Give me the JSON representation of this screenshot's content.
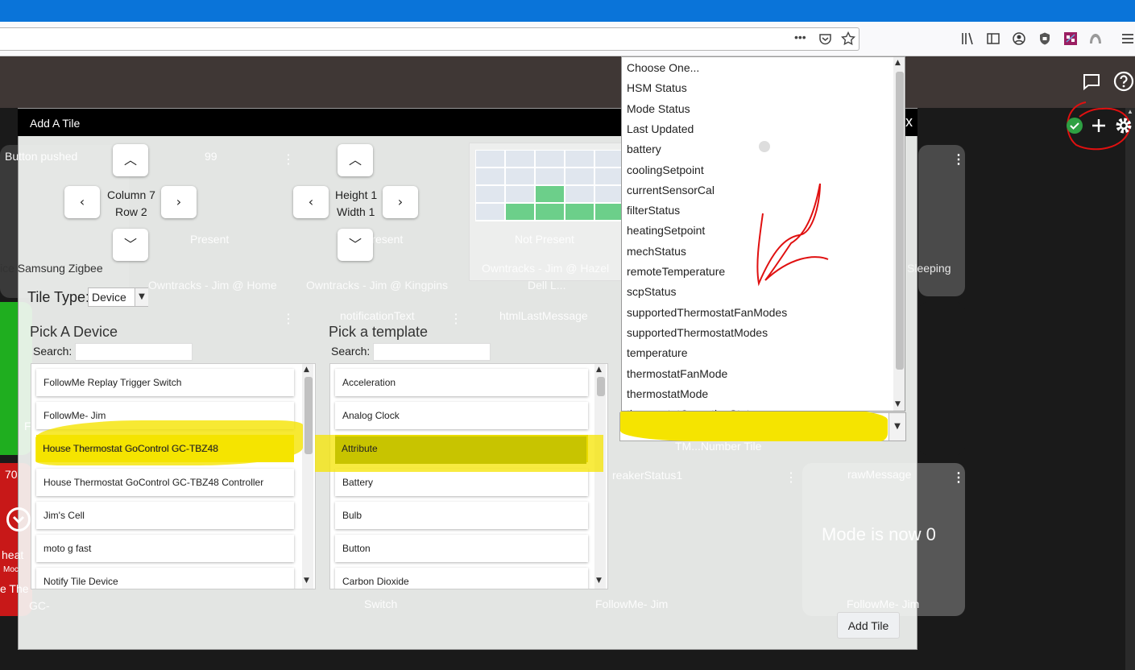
{
  "browser": {
    "url_more": "•••",
    "toolbar_icons": [
      "pocket-icon",
      "star-icon",
      "library-icon",
      "sidebar-icon",
      "account-icon",
      "shield-icon",
      "extension-icon",
      "extension2-icon",
      "menu-icon"
    ]
  },
  "background_tiles": {
    "t1": "Button pushed",
    "t2": "99",
    "t3": "Present",
    "t4": "Present",
    "t5": "Not Present",
    "t6": "ice Samsung Zigbee",
    "t7": "Owntracks - Jim @ Home",
    "t8": "Owntracks - Jim @ Kingpins",
    "t9": "Owntracks - Jim @ Hazel",
    "t10": "Dell L...",
    "t11": "Sleeping",
    "t12": "notificationText",
    "t13": "htmlLastMessage",
    "t14": "70",
    "t15": "rawMessage",
    "t16": "Mode is now 0",
    "t17": "FollowMe- Jim",
    "t18": "FollowMe- Jim",
    "t19": "Switch",
    "t20": "heat",
    "t21": "Moc",
    "t22": "e The",
    "t23": "GC-",
    "t24": "reakerStatus1",
    "t25": "TM...Number Tile",
    "t26": "F"
  },
  "modal": {
    "title": "Add A Tile",
    "close": "x",
    "column_label": "Column 7",
    "row_label": "Row 2",
    "height_label": "Height 1",
    "width_label": "Width 1",
    "tile_type_label": "Tile Type:",
    "tile_type_value": "Device",
    "device_heading": "Pick A Device",
    "template_heading": "Pick a template",
    "search_label": "Search:",
    "devices": [
      "FollowMe Replay Trigger Switch",
      "FollowMe- Jim",
      "House Thermostat GoControl GC-TBZ48",
      "House Thermostat GoControl GC-TBZ48 Controller",
      "Jim's Cell",
      "moto g fast",
      "Notify Tile Device"
    ],
    "templates": [
      "Acceleration",
      "Analog Clock",
      "Attribute",
      "Battery",
      "Bulb",
      "Button",
      "Carbon Dioxide"
    ],
    "add_button": "Add Tile"
  },
  "attribute_dropdown": {
    "options": [
      "Choose One...",
      "HSM Status",
      "Mode Status",
      "Last Updated",
      "battery",
      "coolingSetpoint",
      "currentSensorCal",
      "filterStatus",
      "heatingSetpoint",
      "mechStatus",
      "remoteTemperature",
      "scpStatus",
      "supportedThermostatFanModes",
      "supportedThermostatModes",
      "temperature",
      "thermostatFanMode",
      "thermostatMode",
      "thermostatOperatingState"
    ]
  },
  "colors": {
    "highlight": "#f5e400",
    "accent_blue": "#0a74d9",
    "annotation_red": "#e01010",
    "grid_green": "#6ccf8a"
  }
}
